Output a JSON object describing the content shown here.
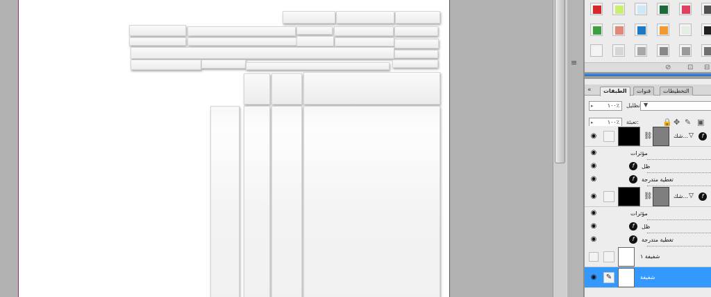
{
  "layers_panel": {
    "tabs": [
      {
        "label": "الطبقات",
        "active": true
      },
      {
        "label": "قنوات",
        "active": false
      },
      {
        "label": "التخطيطات",
        "active": false
      }
    ],
    "collapse_glyph": "«",
    "opacity": {
      "label": "تظليل:",
      "value": "١٠٠٪"
    },
    "fill": {
      "label": "تعبئة:",
      "value": "١٠٠٪"
    },
    "layers": [
      {
        "name": "شك...",
        "effects": [
          "مؤثرات",
          "ظل",
          "تغطية متدرجة"
        ],
        "visible": true
      },
      {
        "name": "شك...",
        "effects": [
          "مؤثرات",
          "ظل",
          "تغطية متدرجة"
        ],
        "visible": true
      },
      {
        "name": "شفيفة ١",
        "visible": false
      },
      {
        "name": "شفيفة",
        "visible": true,
        "selected": true
      }
    ]
  },
  "swatches": {
    "colors": [
      [
        "#d62828",
        "#c8f070",
        "#cfe8f8",
        "#1a6a3a",
        "#e04060",
        "#505050"
      ],
      [
        "#3aa040",
        "#e08878",
        "#1e78c8",
        "#f09a30",
        "#e4efe4",
        "#202020"
      ],
      [
        "#f4f4f4",
        "#d6d6d6",
        "#a8a8a8",
        "#888888",
        "#9a9a9a",
        "#707070"
      ]
    ]
  },
  "colors": {
    "selected_row": "#3399ff",
    "document_bg": "#ffffff",
    "workspace_bg": "#b2b2b2"
  },
  "icons": {
    "eye": "eye-icon",
    "fx": "fx-icon",
    "chain": "chain-icon",
    "lock": "lock-icon",
    "move": "move-icon",
    "brush": "brush-icon",
    "grip": "grip-icon",
    "trash": "trash-icon",
    "new": "new-swatch-icon"
  }
}
